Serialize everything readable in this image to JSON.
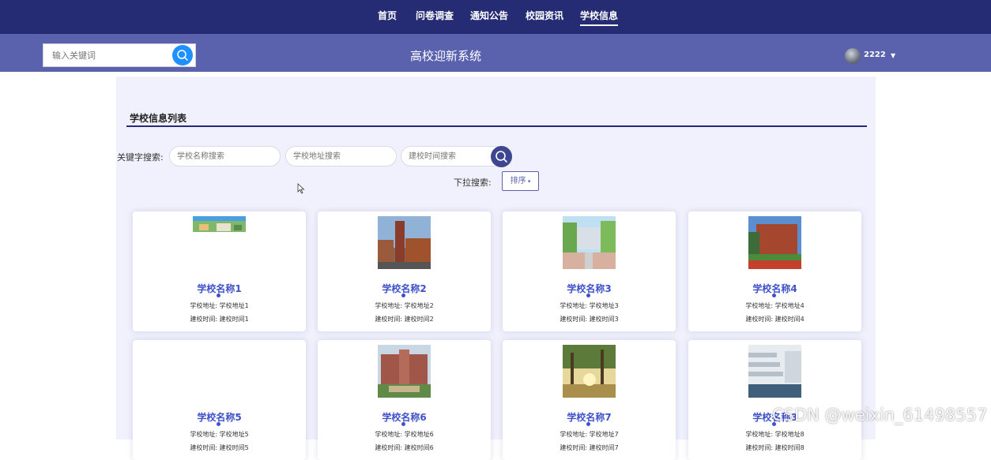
{
  "nav": {
    "items": [
      {
        "label": "首页"
      },
      {
        "label": "问卷调查"
      },
      {
        "label": "通知公告"
      },
      {
        "label": "校园资讯"
      },
      {
        "label": "学校信息"
      }
    ]
  },
  "header": {
    "search_placeholder": "输入关键词",
    "site_title": "高校迎新系统",
    "username": "2222"
  },
  "section": {
    "title": "学校信息列表"
  },
  "filters": {
    "keyword_label": "关键字搜索:",
    "name_placeholder": "学校名称搜索",
    "address_placeholder": "学校地址搜索",
    "time_placeholder": "建校时间搜索",
    "dropdown_label": "下拉搜索:",
    "sort_label": "排序"
  },
  "cards": [
    {
      "name": "学校名称1",
      "address": "学校地址: 学校地址1",
      "founded": "建校时间: 建校时间1"
    },
    {
      "name": "学校名称2",
      "address": "学校地址: 学校地址2",
      "founded": "建校时间: 建校时间2"
    },
    {
      "name": "学校名称3",
      "address": "学校地址: 学校地址3",
      "founded": "建校时间: 建校时间3"
    },
    {
      "name": "学校名称4",
      "address": "学校地址: 学校地址4",
      "founded": "建校时间: 建校时间4"
    },
    {
      "name": "学校名称5",
      "address": "学校地址: 学校地址5",
      "founded": "建校时间: 建校时间5"
    },
    {
      "name": "学校名称6",
      "address": "学校地址: 学校地址6",
      "founded": "建校时间: 建校时间6"
    },
    {
      "name": "学校名称7",
      "address": "学校地址: 学校地址7",
      "founded": "建校时间: 建校时间7"
    },
    {
      "name": "学校名称8",
      "address": "学校地址: 学校地址8",
      "founded": "建校时间: 建校时间8"
    }
  ],
  "watermark": "CSDN @weixin_61498557",
  "colors": {
    "nav_bg": "#252c73",
    "subbar_bg": "#5a62ae",
    "accent": "#3f51c8",
    "search_btn": "#1e90ff"
  }
}
